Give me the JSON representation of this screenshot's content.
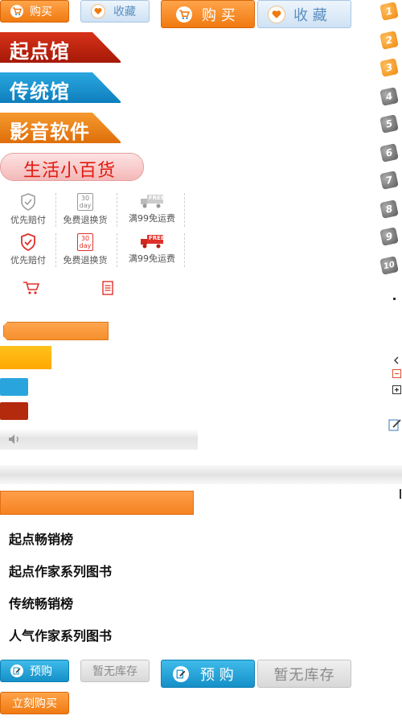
{
  "buttons": {
    "buy_small": "购买",
    "fav_small": "收藏",
    "buy_large": "购 买",
    "fav_large": "收 藏",
    "preorder_small": "预购",
    "outofstock_small": "暂无库存",
    "preorder_large": "预 购",
    "outofstock_large": "暂无库存",
    "buy_now": "立刻购买"
  },
  "banners": {
    "qidian": "起点馆",
    "traditional": "传统馆",
    "media": "影音软件",
    "life": "生活小百货"
  },
  "features": {
    "row1": [
      "优先赔付",
      "免费退换货",
      "满99免运费"
    ],
    "row2": [
      "优先赔付",
      "免费退换货",
      "满99免运费"
    ],
    "thirty_day": [
      "30",
      "day"
    ],
    "free_text": "FREE"
  },
  "rank_numbers": [
    "1",
    "2",
    "3",
    "4",
    "5",
    "6",
    "7",
    "8",
    "9",
    "10"
  ],
  "lists": [
    "起点畅销榜",
    "起点作家系列图书",
    "传统畅销榜",
    "人气作家系列图书"
  ],
  "colors": {
    "orange": "#f07a10",
    "blue": "#1590c8",
    "qidian_red": "#c0200c",
    "pink_text": "#e01a10"
  }
}
